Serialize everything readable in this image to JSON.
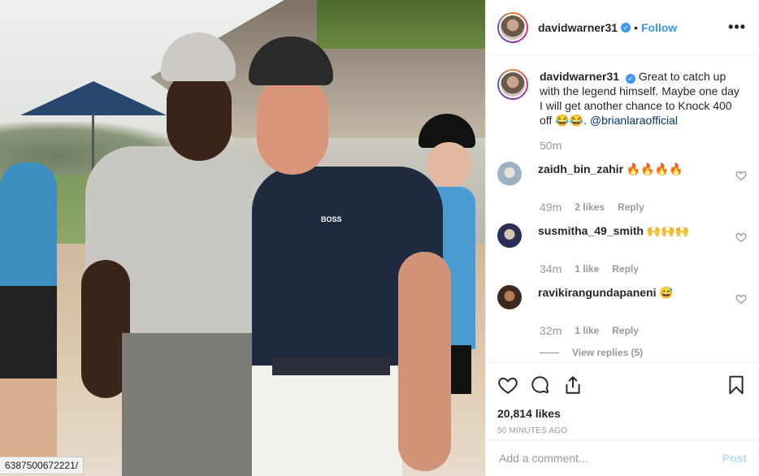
{
  "header": {
    "username": "davidwarner31",
    "verified_mark": "✓",
    "separator": "•",
    "follow_label": "Follow",
    "more_label": "•••"
  },
  "caption": {
    "username": "davidwarner31",
    "text": "Great to catch up with the legend himself. Maybe one day I will get another chance to Knock 400 off 😂😂.",
    "mention": "@brianlaraofficial",
    "time": "50m"
  },
  "comments": [
    {
      "username": "zaidh_bin_zahir",
      "text": "🔥🔥🔥🔥",
      "time": "49m",
      "likes": "2 likes",
      "reply": "Reply"
    },
    {
      "username": "susmitha_49_smith",
      "text": "🙌🙌🙌",
      "time": "34m",
      "likes": "1 like",
      "reply": "Reply"
    },
    {
      "username": "ravikirangundapaneni",
      "text": "😅",
      "time": "32m",
      "likes": "1 like",
      "reply": "Reply",
      "view_replies": "View replies (5)"
    }
  ],
  "actions": {
    "likes": "20,814 likes",
    "timestamp": "50 MINUTES AGO"
  },
  "add_comment": {
    "placeholder": "Add a comment...",
    "post_label": "Post"
  },
  "photo": {
    "url_tooltip": "6387500672221/",
    "shirt_brand": "BOSS"
  },
  "colors": {
    "accent": "#3897f0",
    "post_disabled": "#b2dffc",
    "muted": "#999999"
  },
  "icons": [
    "heart-icon",
    "comment-icon",
    "share-icon",
    "bookmark-icon",
    "verified-icon",
    "more-icon"
  ]
}
